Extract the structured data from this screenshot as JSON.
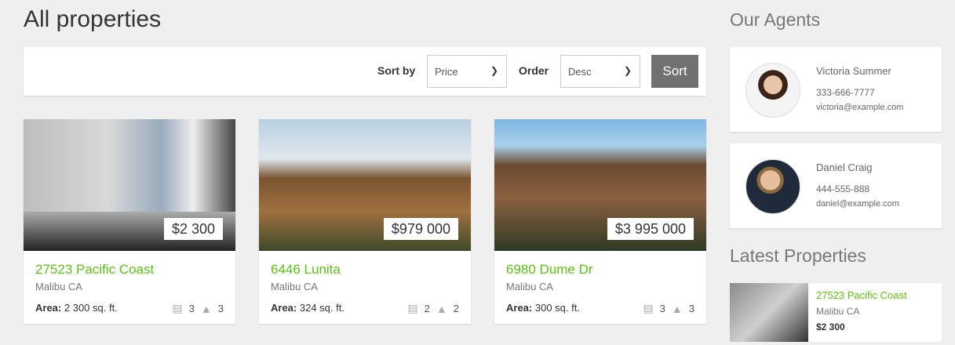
{
  "page_title": "All properties",
  "toolbar": {
    "sort_by_label": "Sort by",
    "sort_by_value": "Price",
    "order_label": "Order",
    "order_value": "Desc",
    "sort_button": "Sort"
  },
  "properties": [
    {
      "price": "$2 300",
      "address": "27523 Pacific Coast",
      "city": "Malibu CA",
      "area_label": "Area:",
      "area": "2 300 sq. ft.",
      "beds": "3",
      "baths": "3"
    },
    {
      "price": "$979 000",
      "address": "6446 Lunita",
      "city": "Malibu CA",
      "area_label": "Area:",
      "area": "324 sq. ft.",
      "beds": "2",
      "baths": "2"
    },
    {
      "price": "$3 995 000",
      "address": "6980 Dume Dr",
      "city": "Malibu CA",
      "area_label": "Area:",
      "area": "300 sq. ft.",
      "beds": "3",
      "baths": "3"
    }
  ],
  "sidebar": {
    "agents_title": "Our Agents",
    "agents": [
      {
        "name": "Victoria Summer",
        "phone": "333-666-7777",
        "email": "victoria@example.com"
      },
      {
        "name": "Daniel Craig",
        "phone": "444-555-888",
        "email": "daniel@example.com"
      }
    ],
    "latest_title": "Latest Properties",
    "latest": [
      {
        "address": "27523 Pacific Coast",
        "city": "Malibu CA",
        "price": "$2 300"
      }
    ]
  },
  "icons": {
    "bed": "bed-icon",
    "shower": "shower-icon",
    "chevron": "chevron-down-icon"
  },
  "colors": {
    "accent": "#5cbf16",
    "button": "#717171"
  }
}
